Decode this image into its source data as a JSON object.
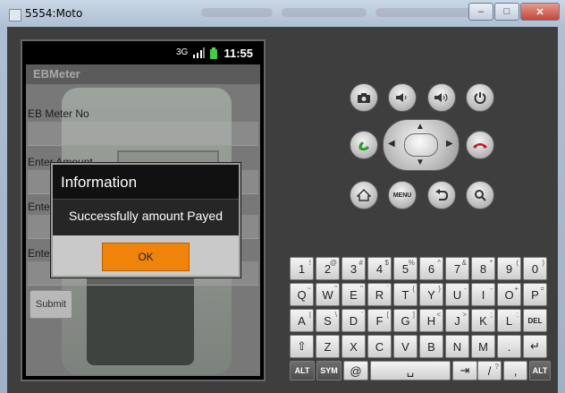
{
  "window": {
    "title": "5554:Moto",
    "min_label": "–",
    "max_label": "□",
    "close_label": "✕"
  },
  "status": {
    "time": "11:55",
    "network_label": "3G"
  },
  "app": {
    "title": "EBMeter",
    "fields": [
      {
        "label": "EB Meter No"
      },
      {
        "label": "Enter Amount"
      },
      {
        "label": "Ente"
      },
      {
        "label": "Ente"
      }
    ],
    "submit_label": "Submit"
  },
  "dialog": {
    "title": "Information",
    "message": "Successfully amount Payed",
    "ok_label": "OK"
  },
  "controls": {
    "menu_label": "MENU"
  },
  "keyboard": {
    "row1": [
      [
        "1",
        "!"
      ],
      [
        "2",
        "@"
      ],
      [
        "3",
        "#"
      ],
      [
        "4",
        "$"
      ],
      [
        "5",
        "%"
      ],
      [
        "6",
        "^"
      ],
      [
        "7",
        "&"
      ],
      [
        "8",
        "*"
      ],
      [
        "9",
        "("
      ],
      [
        "0",
        ")"
      ]
    ],
    "row2": [
      [
        "Q",
        "~"
      ],
      [
        "W",
        "\""
      ],
      [
        "E",
        "\""
      ],
      [
        "R",
        "`"
      ],
      [
        "T",
        "{"
      ],
      [
        "Y",
        "}"
      ],
      [
        "U",
        "-"
      ],
      [
        "I",
        "-"
      ],
      [
        "O",
        "+"
      ],
      [
        "P",
        "="
      ]
    ],
    "row3": [
      [
        "A",
        "|"
      ],
      [
        "S",
        "\\"
      ],
      [
        "D",
        "’"
      ],
      [
        "F",
        "["
      ],
      [
        "G",
        "]"
      ],
      [
        "H",
        "<"
      ],
      [
        "J",
        ">"
      ],
      [
        "K",
        ";"
      ],
      [
        "L",
        ":"
      ],
      [
        "DEL",
        ""
      ]
    ],
    "row4": [
      [
        "⇧",
        ""
      ],
      [
        "Z",
        ""
      ],
      [
        "X",
        ""
      ],
      [
        "C",
        ""
      ],
      [
        "V",
        ""
      ],
      [
        "B",
        ""
      ],
      [
        "N",
        ""
      ],
      [
        "M",
        ""
      ],
      [
        ".",
        ""
      ],
      [
        "↵",
        ""
      ]
    ],
    "row5": {
      "alt": "ALT",
      "sym": "SYM",
      "at": "@",
      "space": "␣",
      "tab": "⇥",
      "slash": "/",
      "slash_alt": "?",
      "comma": ",",
      "alt2": "ALT"
    }
  }
}
